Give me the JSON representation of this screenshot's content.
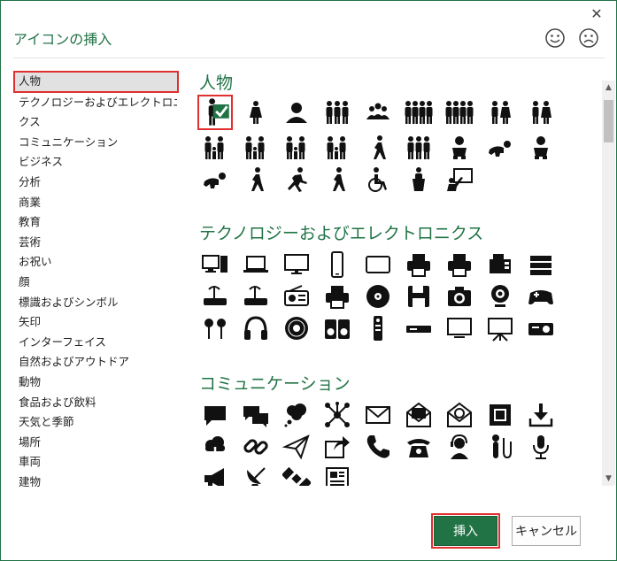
{
  "dialog": {
    "title": "アイコンの挿入",
    "close_glyph": "✕",
    "feedback_icons": [
      "smile-icon",
      "frown-icon"
    ]
  },
  "categories": [
    "人物",
    "テクノロジーおよびエレクトロニ",
    "クス",
    "コミュニケーション",
    "ビジネス",
    "分析",
    "商業",
    "教育",
    "芸術",
    "お祝い",
    "顔",
    "標識およびシンボル",
    "矢印",
    "インターフェイス",
    "自然およびアウトドア",
    "動物",
    "食品および飲料",
    "天気と季節",
    "場所",
    "車両",
    "建物"
  ],
  "selected_category": "人物",
  "sections": {
    "people": "人物",
    "tech": "テクノロジーおよびエレクトロニクス",
    "comm": "コミュニケーション"
  },
  "scrollbar": {
    "up_glyph": "▲",
    "down_glyph": "▼"
  },
  "buttons": {
    "insert": "挿入",
    "cancel": "キャンセル"
  },
  "colors": {
    "accent": "#217346",
    "highlight": "#e03030"
  }
}
